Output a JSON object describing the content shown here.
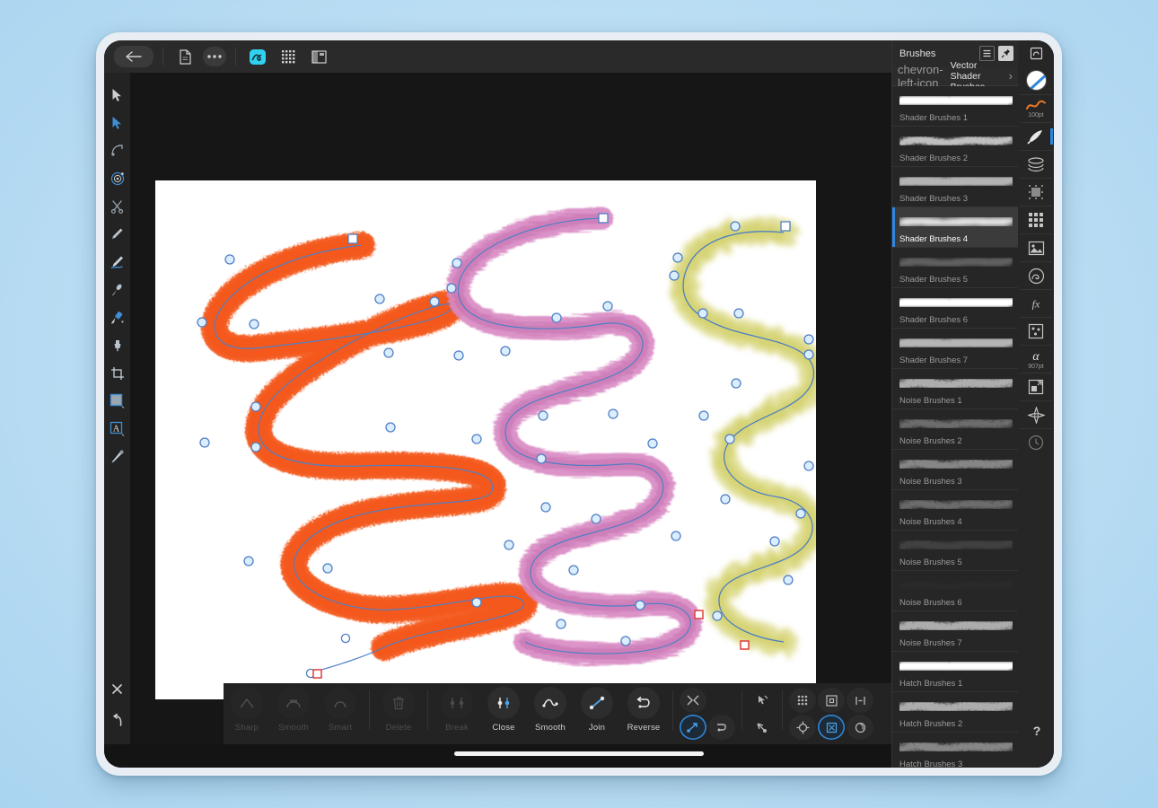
{
  "app": {
    "top_toolbar": [
      {
        "name": "back-button",
        "icon": "arrow-left-icon",
        "active": false
      },
      {
        "name": "document-button",
        "icon": "document-icon",
        "active": false
      },
      {
        "name": "more-button",
        "icon": "ellipsis-icon",
        "active": false
      },
      {
        "name": "pixel-persona-button",
        "icon": "wave-blob-icon",
        "active": true
      },
      {
        "name": "grid-button",
        "icon": "grid-dots-icon",
        "active": false
      },
      {
        "name": "layout-button",
        "icon": "panel-layout-icon",
        "active": false
      }
    ],
    "left_tools": [
      {
        "name": "move-tool",
        "icon": "cursor-arrow-icon",
        "selected": false
      },
      {
        "name": "node-tool",
        "icon": "node-arrow-icon",
        "selected": true
      },
      {
        "name": "corner-tool",
        "icon": "corner-icon",
        "selected": false
      },
      {
        "name": "point-transform-tool",
        "icon": "target-icon",
        "selected": true
      },
      {
        "name": "knife-tool",
        "icon": "scissors-icon",
        "selected": false
      },
      {
        "name": "pen-tool",
        "icon": "pen-icon",
        "selected": false
      },
      {
        "name": "pencil-tool",
        "icon": "pencil-icon",
        "selected": true
      },
      {
        "name": "vector-brush-tool",
        "icon": "brush-icon",
        "selected": false
      },
      {
        "name": "paint-brush-tool",
        "icon": "paintbrush-icon",
        "selected": true
      },
      {
        "name": "fill-tool",
        "icon": "fill-icon",
        "selected": false
      },
      {
        "name": "crop-tool",
        "icon": "crop-icon",
        "selected": false
      },
      {
        "name": "rectangle-tool",
        "icon": "rectangle-icon",
        "selected": true
      },
      {
        "name": "artistic-text-tool",
        "icon": "text-a-icon",
        "selected": true
      },
      {
        "name": "color-picker-tool",
        "icon": "eyedropper-icon",
        "selected": false
      }
    ],
    "left_bottom_tools": [
      {
        "name": "close-button",
        "icon": "close-x-icon"
      },
      {
        "name": "undo-button",
        "icon": "undo-arrow-icon"
      },
      {
        "name": "delete-button",
        "icon": "trash-icon"
      }
    ]
  },
  "node_toolbar": {
    "actions": [
      {
        "label": "Sharp",
        "name": "sharp-node-button",
        "icon": "sharp-node-icon",
        "enabled": false
      },
      {
        "label": "Smooth",
        "name": "smooth-node-button",
        "icon": "smooth-node-icon",
        "enabled": false
      },
      {
        "label": "Smart",
        "name": "smart-node-button",
        "icon": "smart-node-icon",
        "enabled": false
      },
      {
        "label": "Delete",
        "name": "delete-node-button",
        "icon": "trash-icon",
        "enabled": false
      },
      {
        "label": "Break",
        "name": "break-curve-button",
        "icon": "break-curve-icon",
        "enabled": false
      },
      {
        "label": "Close",
        "name": "close-curve-button",
        "icon": "close-curve-icon",
        "enabled": true
      },
      {
        "label": "Smooth",
        "name": "smooth-curve-button",
        "icon": "smooth-curve-icon",
        "enabled": true
      },
      {
        "label": "Join",
        "name": "join-curve-button",
        "icon": "join-curve-icon",
        "enabled": true
      },
      {
        "label": "Reverse",
        "name": "reverse-curve-button",
        "icon": "reverse-curve-icon",
        "enabled": true
      }
    ],
    "mini_group_one": [
      {
        "name": "mirror-nodes-button",
        "icon": "mirror-nodes-icon",
        "on": false
      },
      {
        "name": "convert-shape-button",
        "icon": "convert-shape-icon",
        "on": false
      },
      {
        "name": "transform-mode-button",
        "icon": "transform-mode-icon",
        "on": true
      },
      {
        "name": "curve-handle-button",
        "icon": "curve-handle-icon",
        "on": false
      }
    ],
    "mini_group_two": [
      {
        "name": "select-all-nodes-button",
        "icon": "select-nodes-icon",
        "on": false
      },
      {
        "name": "lasso-select-button",
        "icon": "lasso-icon",
        "on": false
      }
    ],
    "mini_group_three": [
      {
        "name": "show-all-handles-button",
        "icon": "dots-grid-icon",
        "on": false
      },
      {
        "name": "bounding-box-button",
        "icon": "bounding-box-icon",
        "on": false
      },
      {
        "name": "align-nodes-button",
        "icon": "align-nodes-icon",
        "on": false
      },
      {
        "name": "snap-center-button",
        "icon": "snap-center-icon",
        "on": false
      },
      {
        "name": "transform-nodes-button",
        "icon": "transform-nodes-icon",
        "on": true
      },
      {
        "name": "rotate-nodes-button",
        "icon": "rotate-nodes-icon",
        "on": false
      }
    ]
  },
  "brushes_panel": {
    "title": "Brushes",
    "header_buttons": [
      {
        "name": "panel-menu-button",
        "icon": "list-menu-icon",
        "active": false
      },
      {
        "name": "pin-panel-button",
        "icon": "pin-icon",
        "active": true
      }
    ],
    "category": "Vector Shader Brushes",
    "prev_icon": "chevron-left-icon",
    "next_icon": "chevron-right-icon",
    "items": [
      {
        "label": "Shader Brushes 1",
        "style": "solid-soft",
        "selected": false
      },
      {
        "label": "Shader Brushes 2",
        "style": "grain-thin",
        "selected": false
      },
      {
        "label": "Shader Brushes 3",
        "style": "grain-thick",
        "selected": false
      },
      {
        "label": "Shader Brushes 4",
        "style": "soft-glow",
        "selected": true
      },
      {
        "label": "Shader Brushes 5",
        "style": "faint-grain",
        "selected": false
      },
      {
        "label": "Shader Brushes 6",
        "style": "solid-soft",
        "selected": false
      },
      {
        "label": "Shader Brushes 7",
        "style": "grain-thick",
        "selected": false
      },
      {
        "label": "Noise Brushes 1",
        "style": "noise-dense",
        "selected": false
      },
      {
        "label": "Noise Brushes 2",
        "style": "noise-sparse",
        "selected": false
      },
      {
        "label": "Noise Brushes 3",
        "style": "noise-mid",
        "selected": false
      },
      {
        "label": "Noise Brushes 4",
        "style": "noise-sparse",
        "selected": false
      },
      {
        "label": "Noise Brushes 5",
        "style": "noise-faint",
        "selected": false
      },
      {
        "label": "Noise Brushes 6",
        "style": "noise-none",
        "selected": false
      },
      {
        "label": "Noise Brushes 7",
        "style": "noise-dense",
        "selected": false
      },
      {
        "label": "Hatch Brushes 1",
        "style": "solid-soft",
        "selected": false
      },
      {
        "label": "Hatch Brushes 2",
        "style": "noise-dense",
        "selected": false
      },
      {
        "label": "Hatch Brushes 3",
        "style": "noise-mid",
        "selected": false
      }
    ]
  },
  "right_rail": {
    "toggle_icon": "panel-toggle-icon",
    "items": [
      {
        "name": "colour-studio",
        "icon": "colour-wheel-icon",
        "caption": "",
        "active": false
      },
      {
        "name": "stroke-studio",
        "icon": "stroke-curve-icon",
        "caption": "100pt",
        "active": false
      },
      {
        "name": "brushes-studio",
        "icon": "brush-studio-icon",
        "caption": "",
        "active": true
      },
      {
        "name": "layers-studio",
        "icon": "layers-icon",
        "caption": "",
        "active": false
      },
      {
        "name": "adjustment-studio",
        "icon": "adjustment-icon",
        "caption": "",
        "active": false
      },
      {
        "name": "swatches-studio",
        "icon": "swatch-grid-icon",
        "caption": "",
        "active": false
      },
      {
        "name": "assets-studio",
        "icon": "image-icon",
        "caption": "",
        "active": false
      },
      {
        "name": "effects-studio",
        "icon": "effects-circle-icon",
        "caption": "",
        "active": false
      },
      {
        "name": "fx-studio",
        "icon": "fx-icon",
        "caption": "",
        "active": false
      },
      {
        "name": "symbols-studio",
        "icon": "symbols-icon",
        "caption": "",
        "active": false
      },
      {
        "name": "opacity-studio",
        "icon": "alpha-icon",
        "caption": "907pt",
        "active": false
      },
      {
        "name": "export-studio",
        "icon": "export-icon",
        "caption": "",
        "active": false
      },
      {
        "name": "transform-studio",
        "icon": "transform-star-icon",
        "caption": "",
        "active": false
      },
      {
        "name": "history-studio",
        "icon": "history-clock-icon",
        "caption": "",
        "active": false
      }
    ],
    "help_label": "?"
  },
  "colors": {
    "accent_blue": "#2f86e0",
    "active_cyan": "#2fd2ef",
    "stroke_orange": "#f4591a",
    "stroke_pink": "#d98ac4",
    "stroke_yellow": "#cfcc5a",
    "path_blue": "#4f7fc4",
    "node_fill": "#dbeeff",
    "endpoint_red": "#e03c3c",
    "canvas_white": "#ffffff",
    "canvas_backdrop": "#161616",
    "panel_bg": "#222222",
    "desktop_bg": "#bfe0f4"
  },
  "artwork": {
    "description": "Three vector zigzag strokes with visible node paths",
    "strokes": [
      {
        "name": "orange-zigzag-stroke",
        "color": "#f4591a",
        "brush": "dry-bristle",
        "node_count": 14
      },
      {
        "name": "pink-zigzag-stroke",
        "color": "#d98ac4",
        "brush": "soft-hair",
        "node_count": 17
      },
      {
        "name": "yellow-zigzag-stroke",
        "color": "#cfcc5a",
        "brush": "spray-grain",
        "node_count": 15
      }
    ]
  }
}
